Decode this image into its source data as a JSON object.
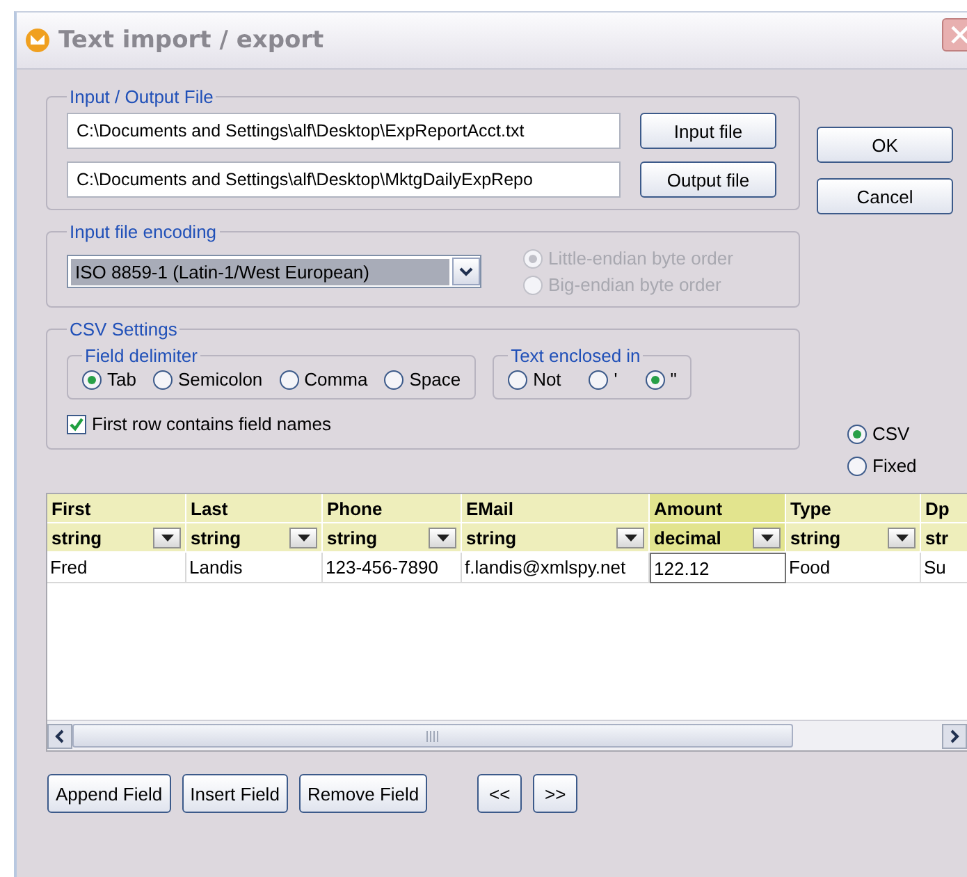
{
  "window": {
    "title": "Text import / export"
  },
  "io_file": {
    "label": "Input / Output File",
    "input_path": "C:\\Documents and Settings\\alf\\Desktop\\ExpReportAcct.txt",
    "output_path": "C:\\Documents and Settings\\alf\\Desktop\\MktgDailyExpRepo",
    "input_button": "Input file",
    "output_button": "Output file"
  },
  "dialog_buttons": [
    "OK",
    "Cancel"
  ],
  "encoding": {
    "label": "Input file encoding",
    "value": "ISO 8859-1 (Latin-1/West European)",
    "byte_order": [
      {
        "label": "Little-endian byte order",
        "selected": true,
        "disabled": true
      },
      {
        "label": "Big-endian byte order",
        "selected": false,
        "disabled": true
      }
    ]
  },
  "csv_settings": {
    "label": "CSV Settings",
    "field_delimiter": {
      "label": "Field delimiter",
      "options": [
        {
          "label": "Tab",
          "selected": true
        },
        {
          "label": "Semicolon",
          "selected": false
        },
        {
          "label": "Comma",
          "selected": false
        },
        {
          "label": "Space",
          "selected": false
        }
      ]
    },
    "text_enclosed": {
      "label": "Text enclosed in",
      "options": [
        {
          "label": "Not",
          "selected": false
        },
        {
          "label": "'",
          "selected": false
        },
        {
          "label": "\"",
          "selected": true
        }
      ]
    },
    "first_row_names": {
      "label": "First row contains field names",
      "checked": true
    }
  },
  "format": [
    {
      "label": "CSV",
      "selected": true
    },
    {
      "label": "Fixed",
      "selected": false
    }
  ],
  "table": {
    "columns": [
      {
        "name": "First",
        "type": "string",
        "selected": false
      },
      {
        "name": "Last",
        "type": "string",
        "selected": false
      },
      {
        "name": "Phone",
        "type": "string",
        "selected": false
      },
      {
        "name": "EMail",
        "type": "string",
        "selected": false
      },
      {
        "name": "Amount",
        "type": "decimal",
        "selected": true
      },
      {
        "name": "Type",
        "type": "string",
        "selected": false
      },
      {
        "name": "Dp",
        "type": "str",
        "selected": false
      }
    ],
    "rows": [
      [
        "Fred",
        "Landis",
        "123-456-7890",
        "f.landis@xmlspy.net",
        "122.12",
        "Food",
        "Su"
      ]
    ]
  },
  "field_buttons": [
    "Append Field",
    "Insert Field",
    "Remove Field"
  ],
  "nav_buttons": [
    "<<",
    ">>"
  ]
}
